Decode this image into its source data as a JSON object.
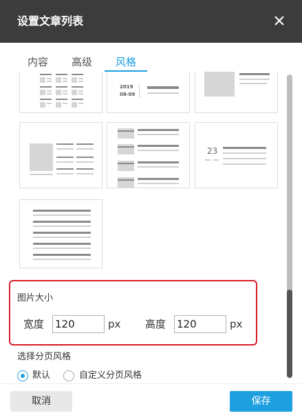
{
  "dialog": {
    "title": "设置文章列表"
  },
  "tabs": [
    {
      "label": "内容",
      "active": false
    },
    {
      "label": "高级",
      "active": false
    },
    {
      "label": "风格",
      "active": true
    }
  ],
  "thumbnails": {
    "date_year": "2019",
    "date_monthday": "08-09",
    "day_number": "23"
  },
  "image_size": {
    "section_title": "图片大小",
    "width_label": "宽度",
    "width_value": "120",
    "height_label": "高度",
    "height_value": "120",
    "unit": "px"
  },
  "pagination": {
    "section_title": "选择分页风格",
    "options": [
      {
        "label": "默认",
        "selected": true
      },
      {
        "label": "自定义分页风格",
        "selected": false
      }
    ]
  },
  "footer": {
    "cancel_label": "取消",
    "save_label": "保存"
  },
  "colors": {
    "accent": "#1e9fe0",
    "titlebar": "#3c3c3c",
    "highlight": "#d71a26"
  }
}
